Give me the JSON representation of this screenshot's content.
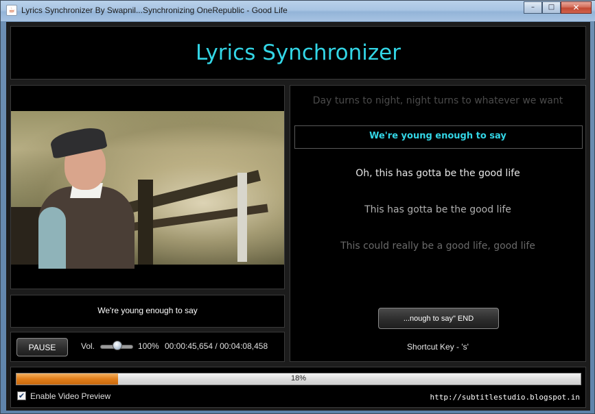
{
  "window": {
    "title": "Lyrics Synchronizer By Swapnil...Synchronizing OneRepublic - Good Life",
    "minimize": "–",
    "maximize": "□",
    "close": "✕",
    "icon": "java-cup-icon"
  },
  "header": {
    "title": "Lyrics Synchronizer"
  },
  "video": {
    "caption": "We're young enough to say"
  },
  "controls": {
    "pause_label": "PAUSE",
    "volume_label": "Vol.",
    "volume_percent": "100%",
    "volume_level": 1.0,
    "time": "00:00:45,654 / 00:04:08,458"
  },
  "lyrics": {
    "previous": "Day turns to night, night turns to whatever we want",
    "current": "We're young enough to say",
    "next1": "Oh, this has gotta be the good life",
    "next2": "This has gotta be the good life",
    "next3": "This could really be a good life, good life",
    "end_button": "...nough to say\" END",
    "shortcut": "Shortcut Key - 's'"
  },
  "progress": {
    "value": 18,
    "label": "18%"
  },
  "footer": {
    "enable_preview_label": "Enable Video Preview",
    "enable_preview_checked": true,
    "url": "http://subtitlestudio.blogspot.in"
  },
  "colors": {
    "accent": "#33d6e6",
    "progress": "#e07d1a",
    "background": "#000000"
  }
}
